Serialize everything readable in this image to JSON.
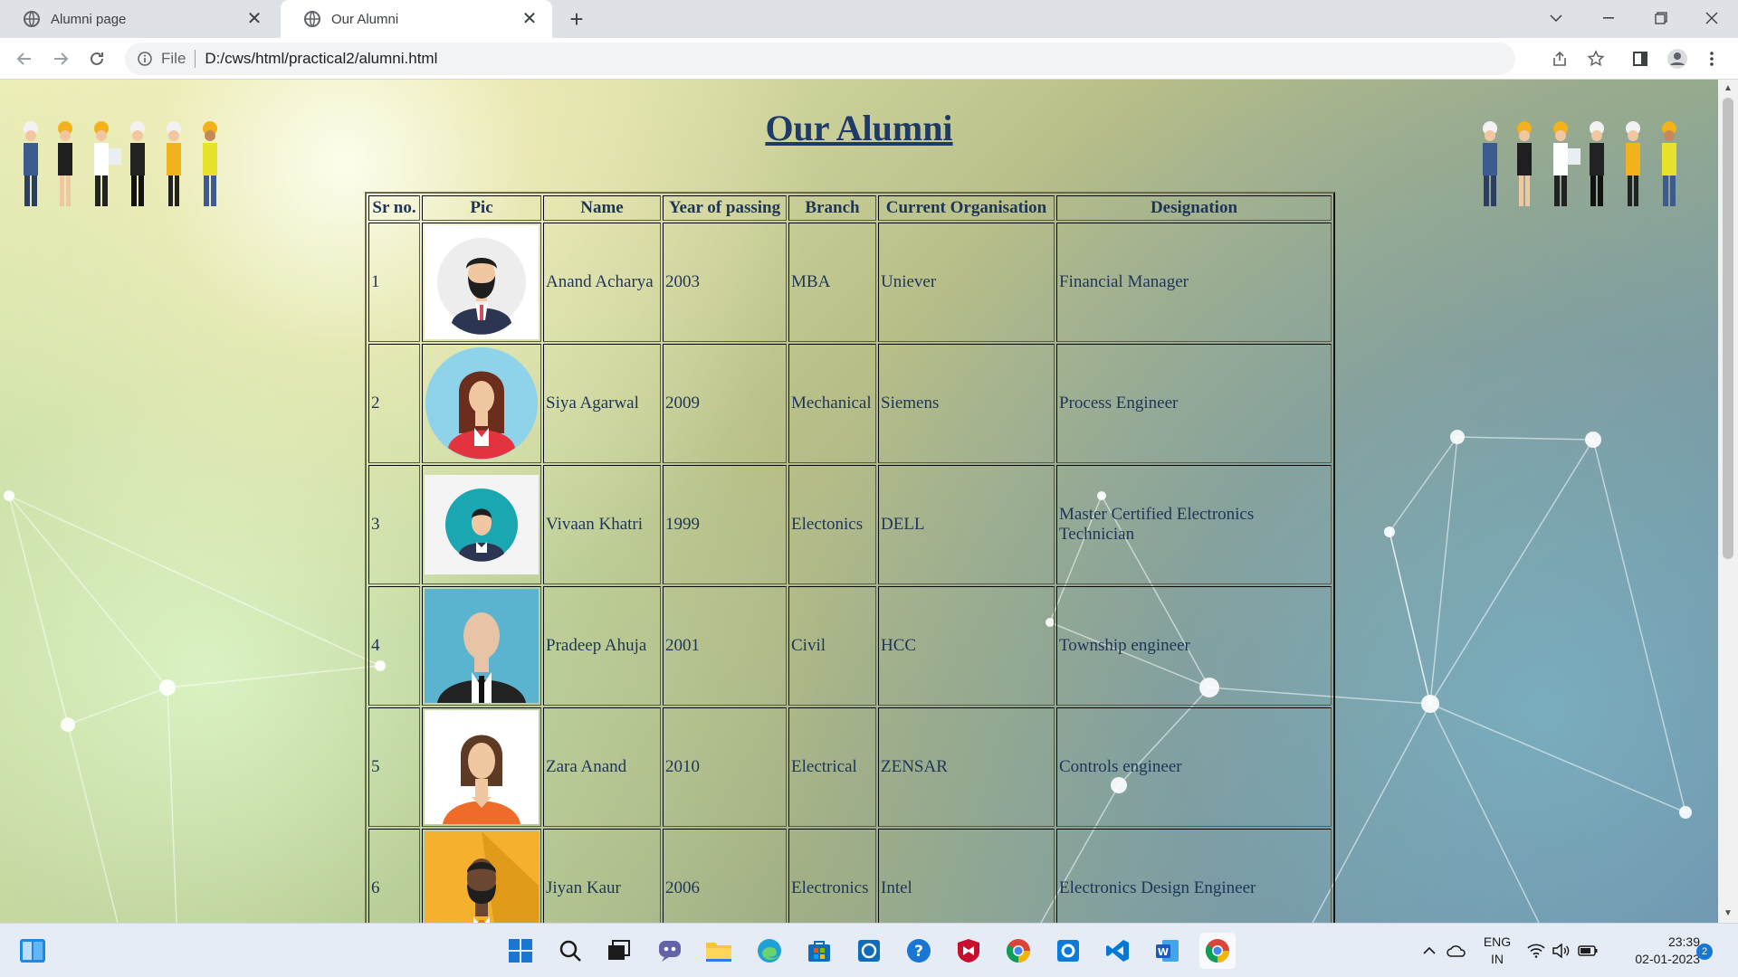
{
  "browser": {
    "tabs": [
      {
        "title": "Alumni page",
        "active": false
      },
      {
        "title": "Our Alumni",
        "active": true
      }
    ],
    "address": {
      "scheme_label": "File",
      "url": "D:/cws/html/practical2/alumni.html"
    }
  },
  "page": {
    "title": "Our Alumni",
    "table": {
      "headers": [
        "Sr no.",
        "Pic",
        "Name",
        "Year of passing",
        "Branch",
        "Current Organisation",
        "Designation"
      ],
      "rows": [
        {
          "sr": "1",
          "name": "Anand Acharya",
          "year": "2003",
          "branch": "MBA",
          "org": "Uniever",
          "designation": "Financial Manager"
        },
        {
          "sr": "2",
          "name": "Siya Agarwal",
          "year": "2009",
          "branch": "Mechanical",
          "org": "Siemens",
          "designation": "Process Engineer"
        },
        {
          "sr": "3",
          "name": "Vivaan Khatri",
          "year": "1999",
          "branch": "Electonics",
          "org": "DELL",
          "designation": "Master Certified Electronics Technician"
        },
        {
          "sr": "4",
          "name": "Pradeep Ahuja",
          "year": "2001",
          "branch": "Civil",
          "org": "HCC",
          "designation": "Township engineer"
        },
        {
          "sr": "5",
          "name": "Zara Anand",
          "year": "2010",
          "branch": "Electrical",
          "org": "ZENSAR",
          "designation": "Controls engineer"
        },
        {
          "sr": "6",
          "name": "Jiyan Kaur",
          "year": "2006",
          "branch": "Electronics",
          "org": "Intel",
          "designation": "Electronics Design Engineer"
        }
      ]
    }
  },
  "taskbar": {
    "language": "ENG",
    "region": "IN",
    "time": "23:39",
    "date": "02-01-2023",
    "notification_count": "2"
  },
  "colors": {
    "title": "#1e3a66",
    "table_text": "#1f3558",
    "chrome_bg": "#dee1e6",
    "taskbar_bg": "#e6ecf5"
  }
}
